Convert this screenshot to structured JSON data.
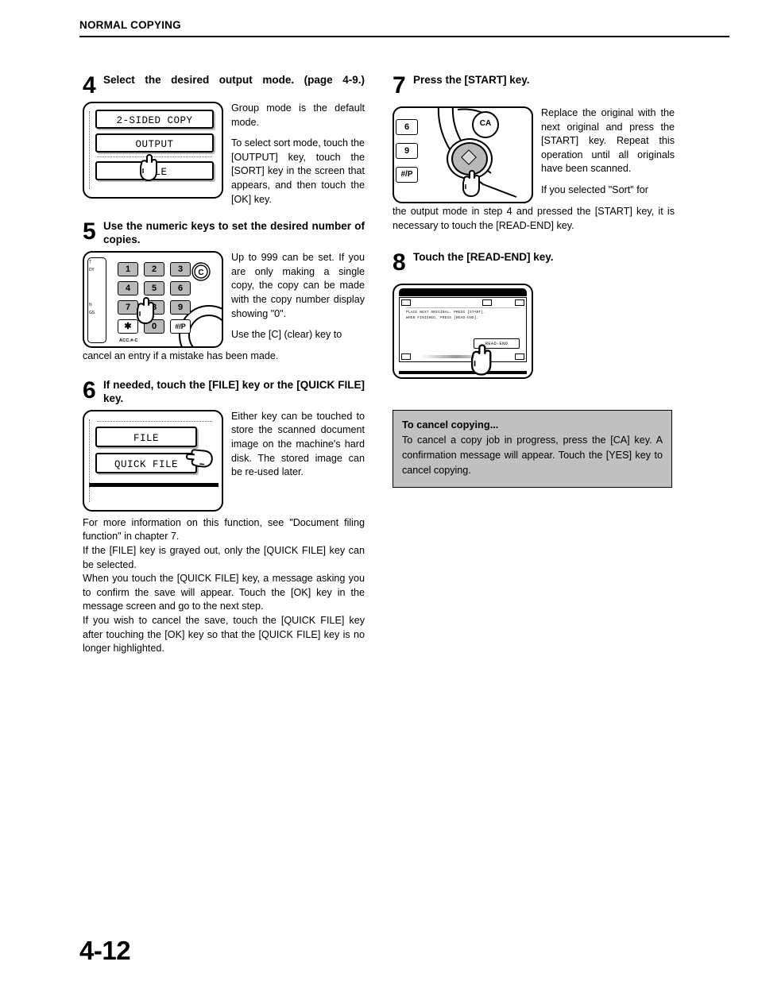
{
  "header": {
    "title": "NORMAL COPYING"
  },
  "folio": "4-12",
  "steps": {
    "step4": {
      "number": "4",
      "title": "Select the desired output mode. (page 4-9.)",
      "figure": {
        "name": "lcd-output-mode",
        "keys": [
          "2-SIDED COPY",
          "OUTPUT",
          "FILE"
        ]
      },
      "paragraphs": [
        "Group mode is the default mode.",
        "To select sort mode, touch the [OUTPUT] key, touch the [SORT] key in the screen that appears, and then touch the [OK] key."
      ]
    },
    "step5": {
      "number": "5",
      "title": "Use the numeric keys to set the desired number of copies.",
      "figure": {
        "name": "numeric-keypad",
        "keys": [
          "1",
          "2",
          "3",
          "4",
          "5",
          "6",
          "7",
          "8",
          "9",
          "✱",
          "0",
          "#/P"
        ],
        "clear_key": "C",
        "acc_label": "ACC.#-C",
        "side_labels": [
          "T",
          "DY",
          "N",
          "GS"
        ]
      },
      "paragraphs": [
        "Up to 999 can be set. If you are only making a single copy, the copy can be made with the copy number display showing \"0\".",
        "Use the [C] (clear) key to"
      ],
      "below": "cancel an entry if a mistake has been made."
    },
    "step6": {
      "number": "6",
      "title": "If needed, touch the [FILE] key or the [QUICK FILE] key.",
      "figure": {
        "name": "lcd-file-keys",
        "keys": [
          "FILE",
          "QUICK FILE"
        ]
      },
      "paragraphs": [
        "Either key can be touched to store the scanned document image on the machine's hard disk. The stored image can be re-used later."
      ],
      "below": [
        "For more information on this function, see \"Document filing function\" in chapter 7.",
        "If the [FILE] key is grayed out, only the [QUICK FILE] key can be selected.",
        "When you touch the [QUICK FILE] key, a message asking you to confirm the save will appear. Touch the [OK] key in the message screen and go to the next step.",
        "If you wish to cancel the save, touch the [QUICK FILE] key after touching the [OK] key so that the [QUICK FILE] key is no longer highlighted."
      ]
    },
    "step7": {
      "number": "7",
      "title": "Press the [START] key.",
      "figure": {
        "name": "start-key-panel",
        "side_keys": [
          "6",
          "9",
          "#/P"
        ],
        "ca_key": "CA"
      },
      "paragraphs": [
        "Replace the original with the next original and press the [START] key. Repeat this operation until all originals have been scanned.",
        "If you selected \"Sort\" for"
      ],
      "below": "the output mode in step 4 and pressed the [START] key, it is necessary to touch the [READ-END] key."
    },
    "step8": {
      "number": "8",
      "title": "Touch the [READ-END] key.",
      "figure": {
        "name": "read-end-screen",
        "message_line1": "PLACE NEXT ORIGINAL. PRESS [START].",
        "message_line2": "WHEN FINISHED, PRESS [READ-END].",
        "button": "READ-END"
      }
    }
  },
  "note": {
    "title": "To cancel copying...",
    "body": "To cancel a copy job in progress, press the [CA] key. A confirmation message will appear. Touch the [YES] key to cancel copying."
  },
  "colors": {
    "note_background": "#c0c0c0",
    "key_fill": "#b9b9b9",
    "ink": "#000000"
  }
}
